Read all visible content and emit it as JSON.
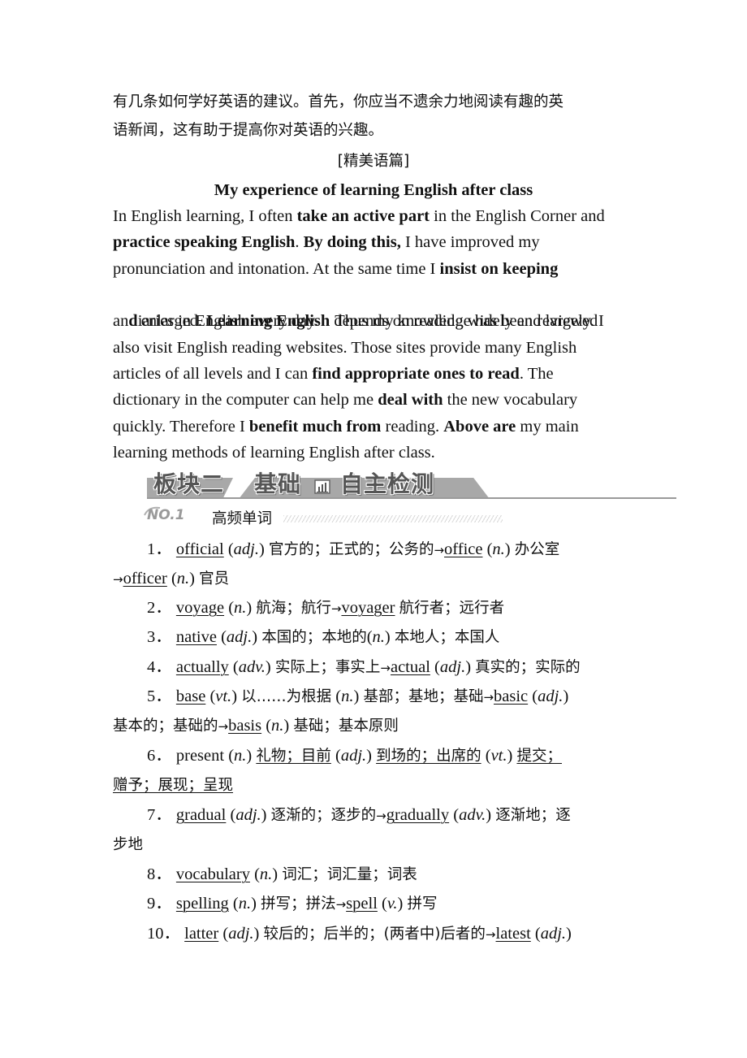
{
  "intro": {
    "line1": "有几条如何学好英语的建议。首先，你应当不遗余力地阅读有趣的英",
    "line2": "语新闻，这有助于提高你对英语的兴趣。"
  },
  "essay": {
    "section_label": "[精美语篇]",
    "title": "My experience of learning English after class",
    "lines": [
      [
        "In English learning, I often ",
        "take an active part",
        " in the English Corner and"
      ],
      [
        "practice speaking English",
        ". ",
        "By doing this,",
        " I have improved my"
      ],
      [
        "pronunciation and intonation. At the same time I ",
        "insist on keeping"
      ],
      [
        "diaries in English every day.    Thus my knowledge has been reviewed"
      ],
      [
        "and enlarged. ",
        "Learning English",
        " depends on reading widely and largely. I"
      ],
      [
        "also visit English reading websites. Those sites provide many English"
      ],
      [
        "articles of all levels and I can ",
        "find appropriate ones to read",
        ". The"
      ],
      [
        "dictionary in the computer can help me ",
        "deal with",
        " the new vocabulary"
      ],
      [
        "quickly. Therefore I ",
        "benefit much from",
        " reading. ",
        "Above are",
        " my main"
      ],
      [
        "learning methods of learning English after class."
      ]
    ]
  },
  "banner": {
    "part": "板块二",
    "left": "基础",
    "right": "自主检测",
    "icon": "bar-chart-icon"
  },
  "subsection": {
    "number": "NO.1",
    "title": "高频单词"
  },
  "vocab": [
    {
      "num": "1．",
      "word": "official",
      "pos": "adj.",
      "meaning": "官方的；正式的；公务的",
      "derived": [
        {
          "word": "office",
          "pos": "n.",
          "meaning": "办公室"
        },
        {
          "word": "officer",
          "pos": "n.",
          "meaning": "官员"
        }
      ]
    },
    {
      "num": "2．",
      "word": "voyage",
      "pos": "n.",
      "meaning": "航海；航行",
      "derived": [
        {
          "word": "voyager",
          "pos": "",
          "meaning": "航行者；远行者"
        }
      ]
    },
    {
      "num": "3．",
      "word": "native",
      "pos": "adj.",
      "meaning": "本国的；本地的",
      "pos2": "n.",
      "meaning2": "本地人；本国人"
    },
    {
      "num": "4．",
      "word": "actually",
      "pos": "adv.",
      "meaning": "实际上；事实上",
      "derived": [
        {
          "word": "actual",
          "pos": "adj.",
          "meaning": "真实的；实际的"
        }
      ]
    },
    {
      "num": "5．",
      "word": "base",
      "pos": "vt.",
      "meaning": "以……为根据",
      "pos2": "n.",
      "meaning2": "基部；基地；基础",
      "derived": [
        {
          "word": "basic",
          "pos": "adj.",
          "meaning": "基本的；基础的"
        },
        {
          "word": "basis",
          "pos": "n.",
          "meaning": "基础；基本原则"
        }
      ]
    },
    {
      "num": "6．",
      "word": "present",
      "pos": "n.",
      "meaning": "礼物；目前",
      "pos2": "adj.",
      "meaning2": "到场的；出席的",
      "pos3": "vt.",
      "meaning3a": "提交；",
      "meaning3b": "赠予；展现；呈现"
    },
    {
      "num": "7．",
      "word": "gradual",
      "pos": "adj.",
      "meaning": "逐渐的；逐步的",
      "derived": [
        {
          "word": "gradually",
          "pos": "adv.",
          "meaning_a": "逐渐地；逐",
          "meaning_b": "步地"
        }
      ]
    },
    {
      "num": "8．",
      "word": "vocabulary",
      "pos": "n.",
      "meaning": "词汇；词汇量；词表"
    },
    {
      "num": "9．",
      "word": "spelling",
      "pos": "n.",
      "meaning": "拼写；拼法",
      "derived": [
        {
          "word": "spell",
          "pos": "v.",
          "meaning": "拼写"
        }
      ]
    },
    {
      "num": "10．",
      "word": "latter",
      "pos": "adj.",
      "meaning": "较后的；后半的；(两者中)后者的",
      "derived": [
        {
          "word": "latest",
          "pos": "adj.",
          "meaning": ""
        }
      ]
    }
  ],
  "symbols": {
    "arrow": "→",
    "open_paren": "(",
    "close_paren": ")"
  }
}
